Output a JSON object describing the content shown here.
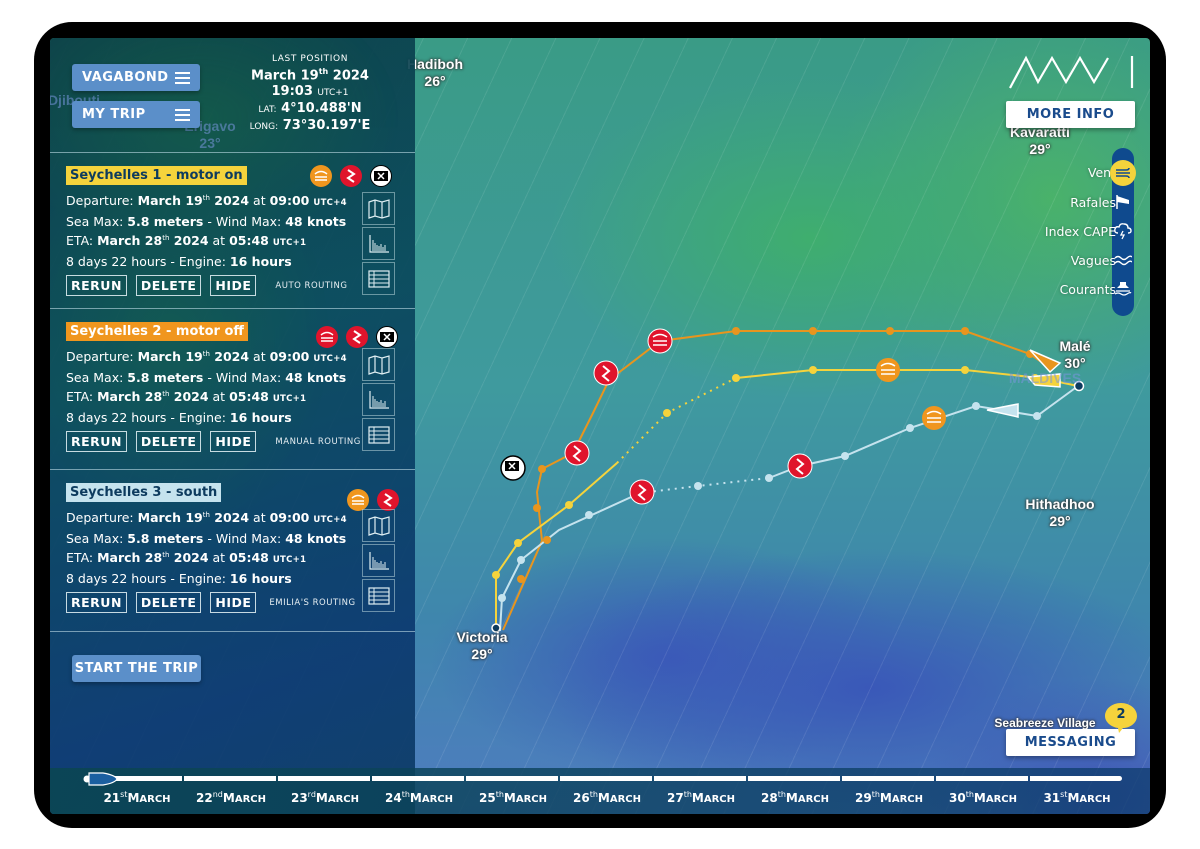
{
  "header": {
    "vessel_button": "VAGABOND",
    "trip_button": "MY TRIP",
    "last_position": {
      "title": "LAST POSITION",
      "date_main": "March 19",
      "date_sup": "th",
      "date_year": " 2024",
      "time": "19:03",
      "tz": "UTC+1",
      "lat_label": "LAT:",
      "lat": "4°10.488'N",
      "long_label": "LONG:",
      "long": "73°30.197'E"
    }
  },
  "trips": [
    {
      "name": "Seychelles 1 - motor on",
      "name_bg": "#f5d33c",
      "name_color": "#0d3b5e",
      "departure_label": "Departure: ",
      "departure": "March 19",
      "departure_sup": "th",
      "departure_rest": " 2024",
      "departure_at": " at ",
      "departure_time": "09:00",
      "departure_tz": "UTC+4",
      "sea_label": "Sea Max: ",
      "sea_max": "5.8 meters",
      "wind_label": " - Wind Max: ",
      "wind_max": "48 knots",
      "eta_label": "ETA: ",
      "eta": "March 28",
      "eta_sup": "th",
      "eta_rest": " 2024",
      "eta_at": " at ",
      "eta_time": "05:48",
      "eta_tz": "UTC+1",
      "duration": "8 days 22 hours - Engine: ",
      "engine": "16 hours",
      "rerun": "RERUN",
      "delete": "DELETE",
      "hide": "HIDE",
      "routing_type": "AUTO ROUTING",
      "status_icons": [
        "wind-warning-orange",
        "lightning-red",
        "flag-x"
      ]
    },
    {
      "name": "Seychelles 2 - motor off",
      "name_bg": "#f0961e",
      "name_color": "#ffffff",
      "departure_label": "Departure: ",
      "departure": "March 19",
      "departure_sup": "th",
      "departure_rest": " 2024",
      "departure_at": " at ",
      "departure_time": "09:00",
      "departure_tz": "UTC+4",
      "sea_label": "Sea Max: ",
      "sea_max": "5.8 meters",
      "wind_label": " - Wind Max: ",
      "wind_max": "48 knots",
      "eta_label": "ETA: ",
      "eta": "March 28",
      "eta_sup": "th",
      "eta_rest": " 2024",
      "eta_at": " at ",
      "eta_time": "05:48",
      "eta_tz": "UTC+1",
      "duration": "8 days 22 hours - Engine: ",
      "engine": "16 hours",
      "rerun": "RERUN",
      "delete": "DELETE",
      "hide": "HIDE",
      "routing_type": "MANUAL ROUTING",
      "status_icons": [
        "wind-warning-red",
        "lightning-red",
        "flag-x"
      ]
    },
    {
      "name": "Seychelles 3 - south",
      "name_bg": "#c5e3ee",
      "name_color": "#0d3b5e",
      "departure_label": "Departure: ",
      "departure": "March 19",
      "departure_sup": "th",
      "departure_rest": " 2024",
      "departure_at": " at ",
      "departure_time": "09:00",
      "departure_tz": "UTC+4",
      "sea_label": "Sea Max: ",
      "sea_max": "5.8 meters",
      "wind_label": " - Wind Max: ",
      "wind_max": "48 knots",
      "eta_label": "ETA: ",
      "eta": "March 28",
      "eta_sup": "th",
      "eta_rest": " 2024",
      "eta_at": " at ",
      "eta_time": "05:48",
      "eta_tz": "UTC+1",
      "duration": "8 days 22 hours - Engine: ",
      "engine": "16 hours",
      "rerun": "RERUN",
      "delete": "DELETE",
      "hide": "HIDE",
      "routing_type": "EMILIA'S ROUTING",
      "status_icons": [
        "wind-warning-orange",
        "lightning-red"
      ]
    }
  ],
  "start_trip": "START THE TRIP",
  "logo_text": "MWI",
  "more_info": "MORE INFO",
  "messaging": "MESSAGING",
  "message_count": "2",
  "layers": [
    {
      "label": "Vent",
      "icon": "wind-icon",
      "active": true
    },
    {
      "label": "Rafales",
      "icon": "windsock-icon",
      "active": false
    },
    {
      "label": "Index CAPE",
      "icon": "storm-cloud-icon",
      "active": false
    },
    {
      "label": "Vagues",
      "icon": "waves-icon",
      "active": false
    },
    {
      "label": "Courants",
      "icon": "boat-current-icon",
      "active": false
    }
  ],
  "map": {
    "places": [
      {
        "name": "Hadiboh",
        "temp": "26°"
      },
      {
        "name": "Kavaratti",
        "temp": "29°"
      },
      {
        "name": "Malé",
        "temp": "30°"
      },
      {
        "name": "Hithadhoo",
        "temp": "29°"
      },
      {
        "name": "Victoria",
        "temp": "29°"
      },
      {
        "name": "Seabreeze Village",
        "temp": ""
      }
    ],
    "faded_places": [
      "Djibouti",
      "Erigavo",
      "23°",
      "MALDIVES"
    ],
    "route_colors": {
      "route1": "#f5d33c",
      "route2": "#e8951e",
      "route3": "#c5e3ee"
    }
  },
  "timeline": {
    "days": [
      {
        "num": "21",
        "sup": "st",
        "month": "March"
      },
      {
        "num": "22",
        "sup": "nd",
        "month": "March"
      },
      {
        "num": "23",
        "sup": "rd",
        "month": "March"
      },
      {
        "num": "24",
        "sup": "th",
        "month": "March"
      },
      {
        "num": "25",
        "sup": "th",
        "month": "March"
      },
      {
        "num": "26",
        "sup": "th",
        "month": "March"
      },
      {
        "num": "27",
        "sup": "th",
        "month": "March"
      },
      {
        "num": "28",
        "sup": "th",
        "month": "March"
      },
      {
        "num": "29",
        "sup": "th",
        "month": "March"
      },
      {
        "num": "30",
        "sup": "th",
        "month": "March"
      },
      {
        "num": "31",
        "sup": "st",
        "month": "March"
      }
    ],
    "progress": 0
  }
}
